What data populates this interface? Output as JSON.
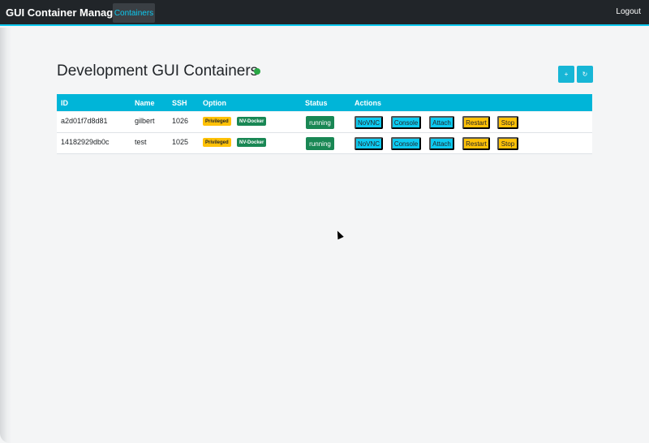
{
  "navbar": {
    "brand": "GUI Container Manager",
    "active_link": "Containers",
    "logout": "Logout"
  },
  "page": {
    "title": "Development GUI Containers",
    "add_button": "+",
    "refresh_button": "↻",
    "status_dot_color": "#28a745"
  },
  "table": {
    "headers": [
      "ID",
      "Name",
      "SSH",
      "Option",
      "Status",
      "Actions"
    ],
    "rows": [
      {
        "id": "a2d01f7d8d81",
        "name": "gilbert",
        "ssh": "1026",
        "options": [
          "Privileged",
          "NV-Docker"
        ],
        "status": "running",
        "actions": [
          "NoVNC",
          "Console",
          "Attach",
          "Restart",
          "Stop"
        ]
      },
      {
        "id": "14182929db0c",
        "name": "test",
        "ssh": "1025",
        "options": [
          "Privileged",
          "NV-Docker"
        ],
        "status": "running",
        "actions": [
          "NoVNC",
          "Console",
          "Attach",
          "Restart",
          "Stop"
        ]
      }
    ]
  },
  "colors": {
    "navbar": "#212529",
    "accent": "#0dcaf0",
    "table_header": "#00b5d8",
    "success": "#198754",
    "warning": "#ffc107"
  }
}
